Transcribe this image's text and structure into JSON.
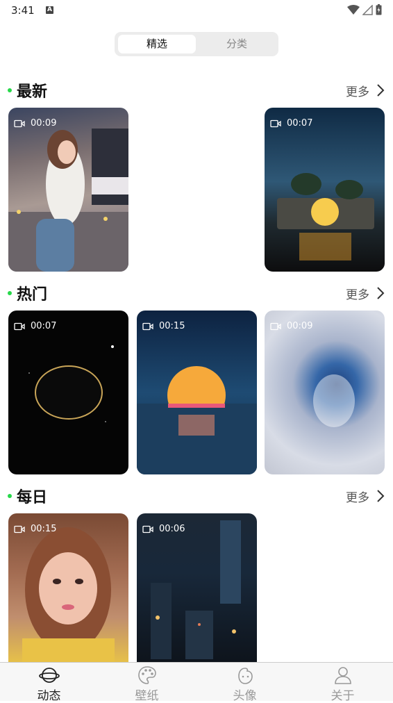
{
  "status_bar": {
    "time": "3:41",
    "notification_icon": "A"
  },
  "segment": {
    "active": "精选",
    "inactive": "分类"
  },
  "sections": [
    {
      "title": "最新",
      "more": "更多",
      "cards": [
        {
          "duration": "00:09"
        },
        {
          "duration": "00:07"
        }
      ]
    },
    {
      "title": "热门",
      "more": "更多",
      "cards": [
        {
          "duration": "00:07"
        },
        {
          "duration": "00:15"
        },
        {
          "duration": "00:09"
        }
      ]
    },
    {
      "title": "每日",
      "more": "更多",
      "cards": [
        {
          "duration": "00:15"
        },
        {
          "duration": "00:06"
        }
      ]
    }
  ],
  "nav": [
    {
      "label": "动态",
      "icon": "planet-icon",
      "active": true
    },
    {
      "label": "壁纸",
      "icon": "palette-icon",
      "active": false
    },
    {
      "label": "头像",
      "icon": "avatar-face-icon",
      "active": false
    },
    {
      "label": "关于",
      "icon": "person-icon",
      "active": false
    }
  ],
  "colors": {
    "accent_dot": "#27d84a",
    "segment_bg": "#ececec",
    "nav_bg": "#f7f7f7"
  }
}
